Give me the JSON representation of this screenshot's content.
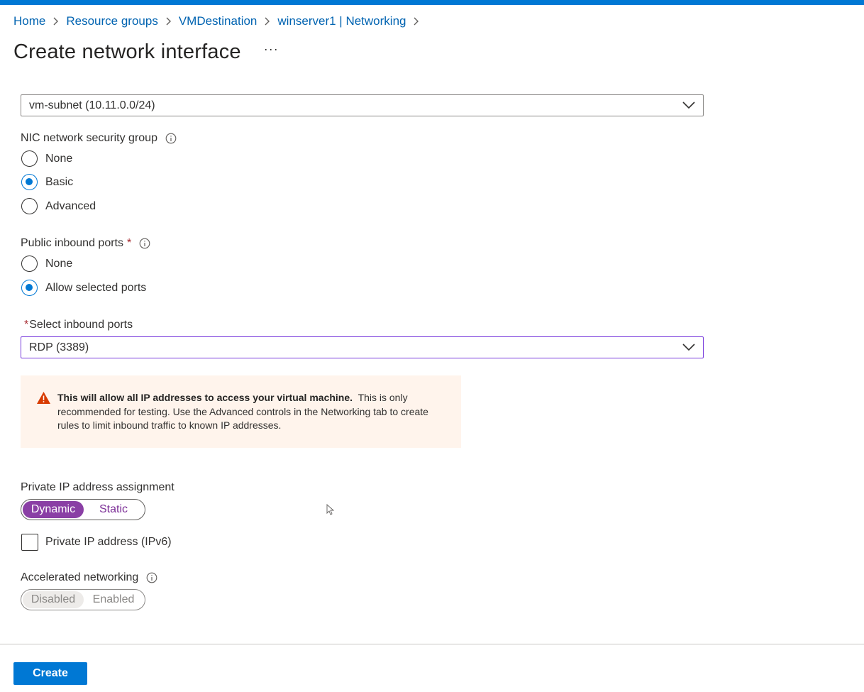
{
  "breadcrumb": {
    "items": [
      "Home",
      "Resource groups",
      "VMDestination",
      "winserver1 | Networking"
    ]
  },
  "page": {
    "title": "Create network interface",
    "more": "···"
  },
  "subnet": {
    "value": "vm-subnet (10.11.0.0/24)"
  },
  "nsg": {
    "label": "NIC network security group",
    "options": [
      "None",
      "Basic",
      "Advanced"
    ],
    "selected": "Basic"
  },
  "public_ports": {
    "label": "Public inbound ports",
    "required": "*",
    "options": [
      "None",
      "Allow selected ports"
    ],
    "selected": "Allow selected ports"
  },
  "inbound_ports": {
    "required": "*",
    "label": "Select inbound ports",
    "value": "RDP (3389)"
  },
  "warning": {
    "bold": "This will allow all IP addresses to access your virtual machine.",
    "text": "This is only recommended for testing.  Use the Advanced controls in the Networking tab to create rules to limit inbound traffic to known IP addresses."
  },
  "private_ip": {
    "label": "Private IP address assignment",
    "options": [
      "Dynamic",
      "Static"
    ],
    "selected": "Dynamic"
  },
  "ipv6": {
    "label": "Private IP address (IPv6)",
    "checked": false
  },
  "accel": {
    "label": "Accelerated networking",
    "options": [
      "Disabled",
      "Enabled"
    ],
    "selected": "Disabled",
    "disabled": true
  },
  "footer": {
    "create_label": "Create"
  },
  "colors": {
    "accent": "#0078d4",
    "toggle_selected": "#8a3fa5",
    "warning_bg": "#fff4ec",
    "warning_icon": "#d83b01",
    "required": "#a4262c"
  }
}
